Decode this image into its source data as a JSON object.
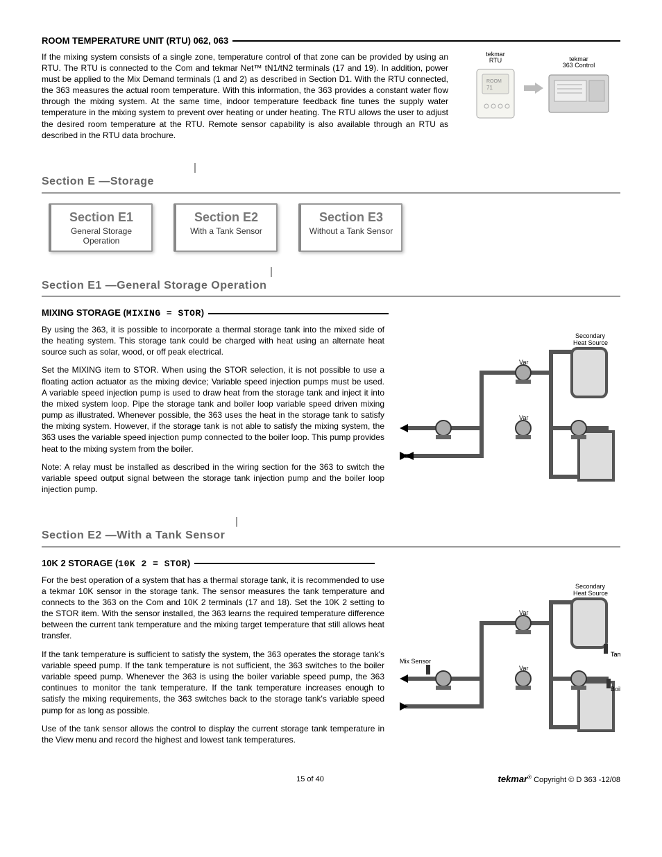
{
  "rtu": {
    "heading": "ROOM TEMPERATURE UNIT (RTU) 062, 063",
    "para": "If the mixing system consists of a single zone, temperature control of that zone can be provided by using an RTU. The RTU is connected to the Com and tekmar Net™ tN1/tN2 terminals (17 and 19). In addition, power must be applied to the Mix Demand terminals (1 and 2) as described in Section D1. With the RTU connected, the 363 measures the actual room temperature. With this information, the 363 provides a constant water flow through the mixing system. At the same time, indoor temperature feedback fine tunes the supply water temperature in the mixing system to prevent over heating or under heating. The RTU allows the user to adjust the desired room temperature at the RTU. Remote sensor capability is also available through an RTU as described in the RTU data brochure.",
    "fig_left_label": "tekmar\nRTU",
    "fig_right_label": "tekmar\n363 Control"
  },
  "sectionE": {
    "title": "Section E —Storage",
    "cards": [
      {
        "title": "Section E1",
        "sub": "General Storage Operation"
      },
      {
        "title": "Section E2",
        "sub": "With a Tank Sensor"
      },
      {
        "title": "Section E3",
        "sub": "Without a Tank Sensor"
      }
    ]
  },
  "sectionE1": {
    "title": "Section E1 —General Storage Operation",
    "sub_heading_prefix": "MIXING STORAGE (",
    "sub_heading_lcd": "MIXING = STOR",
    "sub_heading_suffix": ")",
    "p1": "By using the 363, it is possible to incorporate a thermal storage tank into the mixed side of the heating system. This storage tank could be charged with heat using an alternate heat source such as solar, wood, or off peak electrical.",
    "p2": "Set the MIXING item to STOR. When using the STOR selection, it is not possible to use a floating action actuator as the mixing device; Variable speed injection pumps must be used. A variable speed injection pump is used to draw heat from the storage tank and inject it into the mixed system loop. Pipe the storage tank and boiler loop variable speed driven mixing pump as illustrated. Whenever possible, the 363 uses the heat in the storage tank to satisfy the mixing system. However, if the storage tank is not able to satisfy the mixing system, the 363 uses the variable speed injection pump connected to the boiler loop. This pump  provides heat to the mixing system from the boiler.",
    "p3": "Note: A relay must be installed as described in the wiring section  for the 363 to switch the variable speed output signal between the storage tank injection pump and the boiler loop injection pump.",
    "fig_labels": {
      "secondary": "Secondary\nHeat Source",
      "var": "Var"
    }
  },
  "sectionE2": {
    "title": "Section E2 —With a Tank Sensor",
    "sub_heading_prefix": "10K 2  STORAGE (",
    "sub_heading_lcd": "10K 2 = STOR",
    "sub_heading_suffix": ")",
    "p1": "For the best operation of a system that has a thermal storage tank, it is recommended to use a tekmar 10K sensor in the storage tank. The sensor measures the tank temperature and connects to the 363 on the Com and 10K 2 terminals (17 and 18). Set the 10K 2 setting to the STOR item. With the sensor installed, the 363 learns the required temperature difference between the current tank temperature and the mixing target temperature that still allows heat transfer.",
    "p2": "If the tank temperature is sufficient to satisfy the system, the 363 operates the storage tank's variable speed pump. If the tank temperature is not sufficient, the 363 switches to the boiler variable speed pump. Whenever the 363 is using the boiler variable speed pump, the 363 continues to monitor the tank temperature. If the tank temperature increases enough to satisfy the mixing requirements, the 363 switches back to the storage tank's variable speed pump for as long as possible.",
    "p3": "Use of the tank sensor allows the control to display the current storage tank temperature in the View menu and record the highest and lowest tank temperatures.",
    "fig_labels": {
      "secondary": "Secondary\nHeat Source",
      "var": "Var",
      "mix": "Mix Sensor",
      "tank": "Tank Sensor",
      "boiler": "Boiler Sensor"
    }
  },
  "footer": {
    "page": "15 of 40",
    "brand": "tekmar",
    "copyright": " Copyright © D 363 -12/08"
  }
}
